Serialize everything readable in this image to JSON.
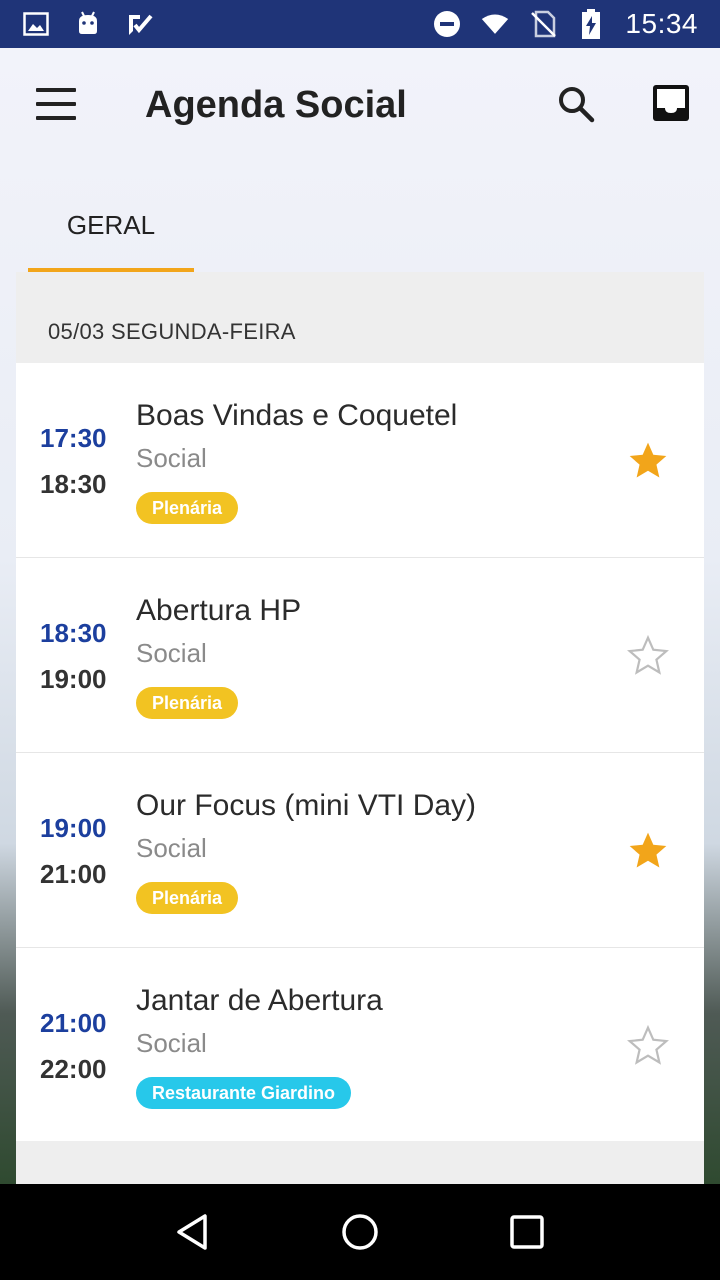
{
  "status_bar": {
    "time": "15:34",
    "left_icons": [
      "image-icon",
      "android-icon",
      "clipboard-check-icon"
    ],
    "right_icons": [
      "do-not-disturb-icon",
      "wifi-icon",
      "no-sim-icon",
      "battery-charging-icon"
    ]
  },
  "app_bar": {
    "title": "Agenda Social",
    "icons": [
      "menu-icon",
      "search-icon",
      "inbox-icon"
    ]
  },
  "tabs": [
    {
      "label": "GERAL",
      "selected": true
    }
  ],
  "date_header": "05/03 SEGUNDA-FEIRA",
  "events": [
    {
      "start": "17:30",
      "end": "18:30",
      "title": "Boas Vindas e Coquetel",
      "category": "Social",
      "location": "Plenária",
      "location_color": "#f2c322",
      "favorite": true
    },
    {
      "start": "18:30",
      "end": "19:00",
      "title": "Abertura HP",
      "category": "Social",
      "location": "Plenária",
      "location_color": "#f2c322",
      "favorite": false
    },
    {
      "start": "19:00",
      "end": "21:00",
      "title": "Our Focus (mini VTI Day)",
      "category": "Social",
      "location": "Plenária",
      "location_color": "#f2c322",
      "favorite": true
    },
    {
      "start": "21:00",
      "end": "22:00",
      "title": "Jantar de Abertura",
      "category": "Social",
      "location": "Restaurante Giardino",
      "location_color": "#27c8ea",
      "favorite": false
    }
  ],
  "colors": {
    "status_bar": "#1f3478",
    "accent": "#f2a51a",
    "start_time": "#1c3f9e",
    "star_filled": "#f2a51a",
    "star_outline": "#bdbdbd"
  },
  "nav_bar": {
    "icons": [
      "back-icon",
      "home-icon",
      "recents-icon"
    ]
  }
}
